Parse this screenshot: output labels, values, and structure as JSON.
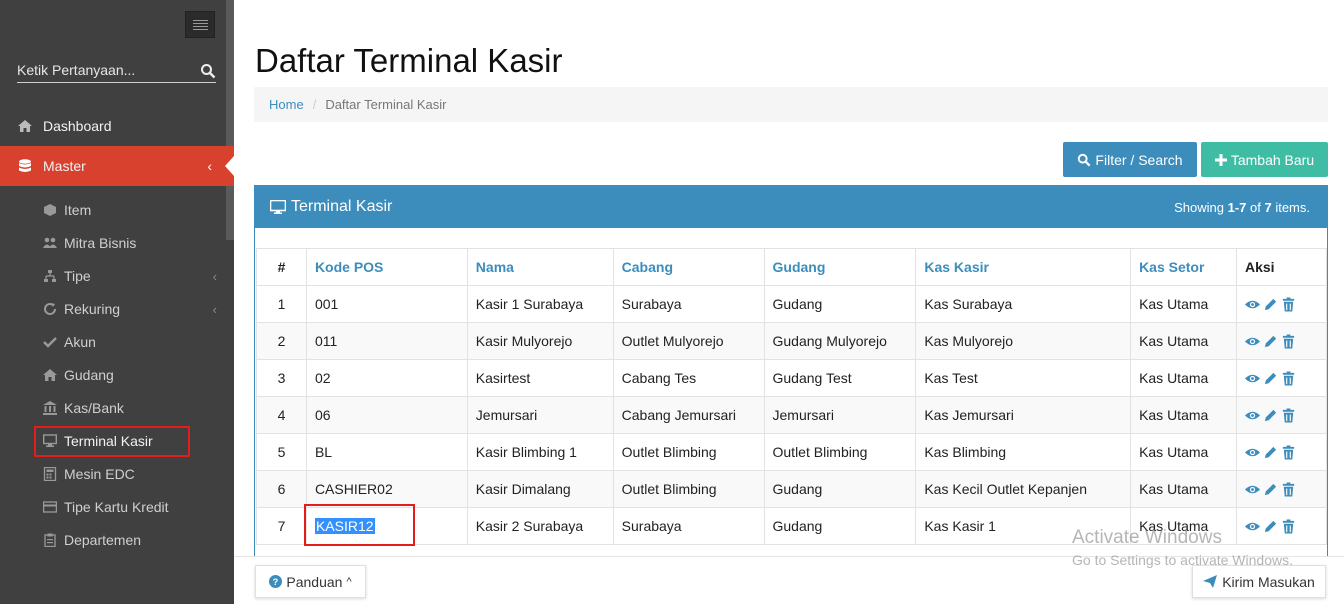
{
  "sidebar": {
    "search_placeholder": "Ketik Pertanyaan...",
    "dashboard": "Dashboard",
    "master": "Master",
    "items": [
      {
        "label": "Item",
        "icon": "cube-icon"
      },
      {
        "label": "Mitra Bisnis",
        "icon": "users-icon"
      },
      {
        "label": "Tipe",
        "icon": "sitemap-icon",
        "chevron": true
      },
      {
        "label": "Rekuring",
        "icon": "refresh-icon",
        "chevron": true
      },
      {
        "label": "Akun",
        "icon": "check-icon"
      },
      {
        "label": "Gudang",
        "icon": "home-icon"
      },
      {
        "label": "Kas/Bank",
        "icon": "bank-icon"
      },
      {
        "label": "Terminal Kasir",
        "icon": "monitor-icon"
      },
      {
        "label": "Mesin EDC",
        "icon": "calculator-icon"
      },
      {
        "label": "Tipe Kartu Kredit",
        "icon": "credit-card-icon"
      },
      {
        "label": "Departemen",
        "icon": "clipboard-icon"
      }
    ],
    "accent_color": "#d9412f"
  },
  "page": {
    "title": "Daftar Terminal Kasir",
    "breadcrumb_home": "Home",
    "breadcrumb_sep": "/",
    "breadcrumb_current": "Daftar Terminal Kasir"
  },
  "toolbar": {
    "filter_label": "Filter / Search",
    "add_label": "Tambah Baru"
  },
  "panel": {
    "title": "Terminal Kasir",
    "showing_prefix": "Showing ",
    "showing_range": "1-7",
    "showing_of": " of ",
    "showing_total": "7",
    "showing_suffix": " items.",
    "color": "#3c8dbc"
  },
  "table": {
    "headers": [
      "#",
      "Kode POS",
      "Nama",
      "Cabang",
      "Gudang",
      "Kas Kasir",
      "Kas Setor",
      "Aksi"
    ],
    "rows": [
      [
        "1",
        "001",
        "Kasir 1 Surabaya",
        "Surabaya",
        "Gudang",
        "Kas Surabaya",
        "Kas Utama"
      ],
      [
        "2",
        "011",
        "Kasir Mulyorejo",
        "Outlet Mulyorejo",
        "Gudang Mulyorejo",
        "Kas Mulyorejo",
        "Kas Utama"
      ],
      [
        "3",
        "02",
        "Kasirtest",
        "Cabang Tes",
        "Gudang Test",
        "Kas Test",
        "Kas Utama"
      ],
      [
        "4",
        "06",
        "Jemursari",
        "Cabang Jemursari",
        "Jemursari",
        "Kas Jemursari",
        "Kas Utama"
      ],
      [
        "5",
        "BL",
        "Kasir Blimbing 1",
        "Outlet Blimbing",
        "Outlet Blimbing",
        "Kas Blimbing",
        "Kas Utama"
      ],
      [
        "6",
        "CASHIER02",
        "Kasir Dimalang",
        "Outlet Blimbing",
        "Gudang",
        "Kas Kecil Outlet Kepanjen",
        "Kas Utama"
      ],
      [
        "7",
        "KASIR12",
        "Kasir 2 Surabaya",
        "Surabaya",
        "Gudang",
        "Kas Kasir 1",
        "Kas Utama"
      ]
    ]
  },
  "footer": {
    "panduan": "Panduan",
    "kirim": "Kirim Masukan"
  },
  "watermark": {
    "line1": "Activate Windows",
    "line2": "Go to Settings to activate Windows."
  }
}
